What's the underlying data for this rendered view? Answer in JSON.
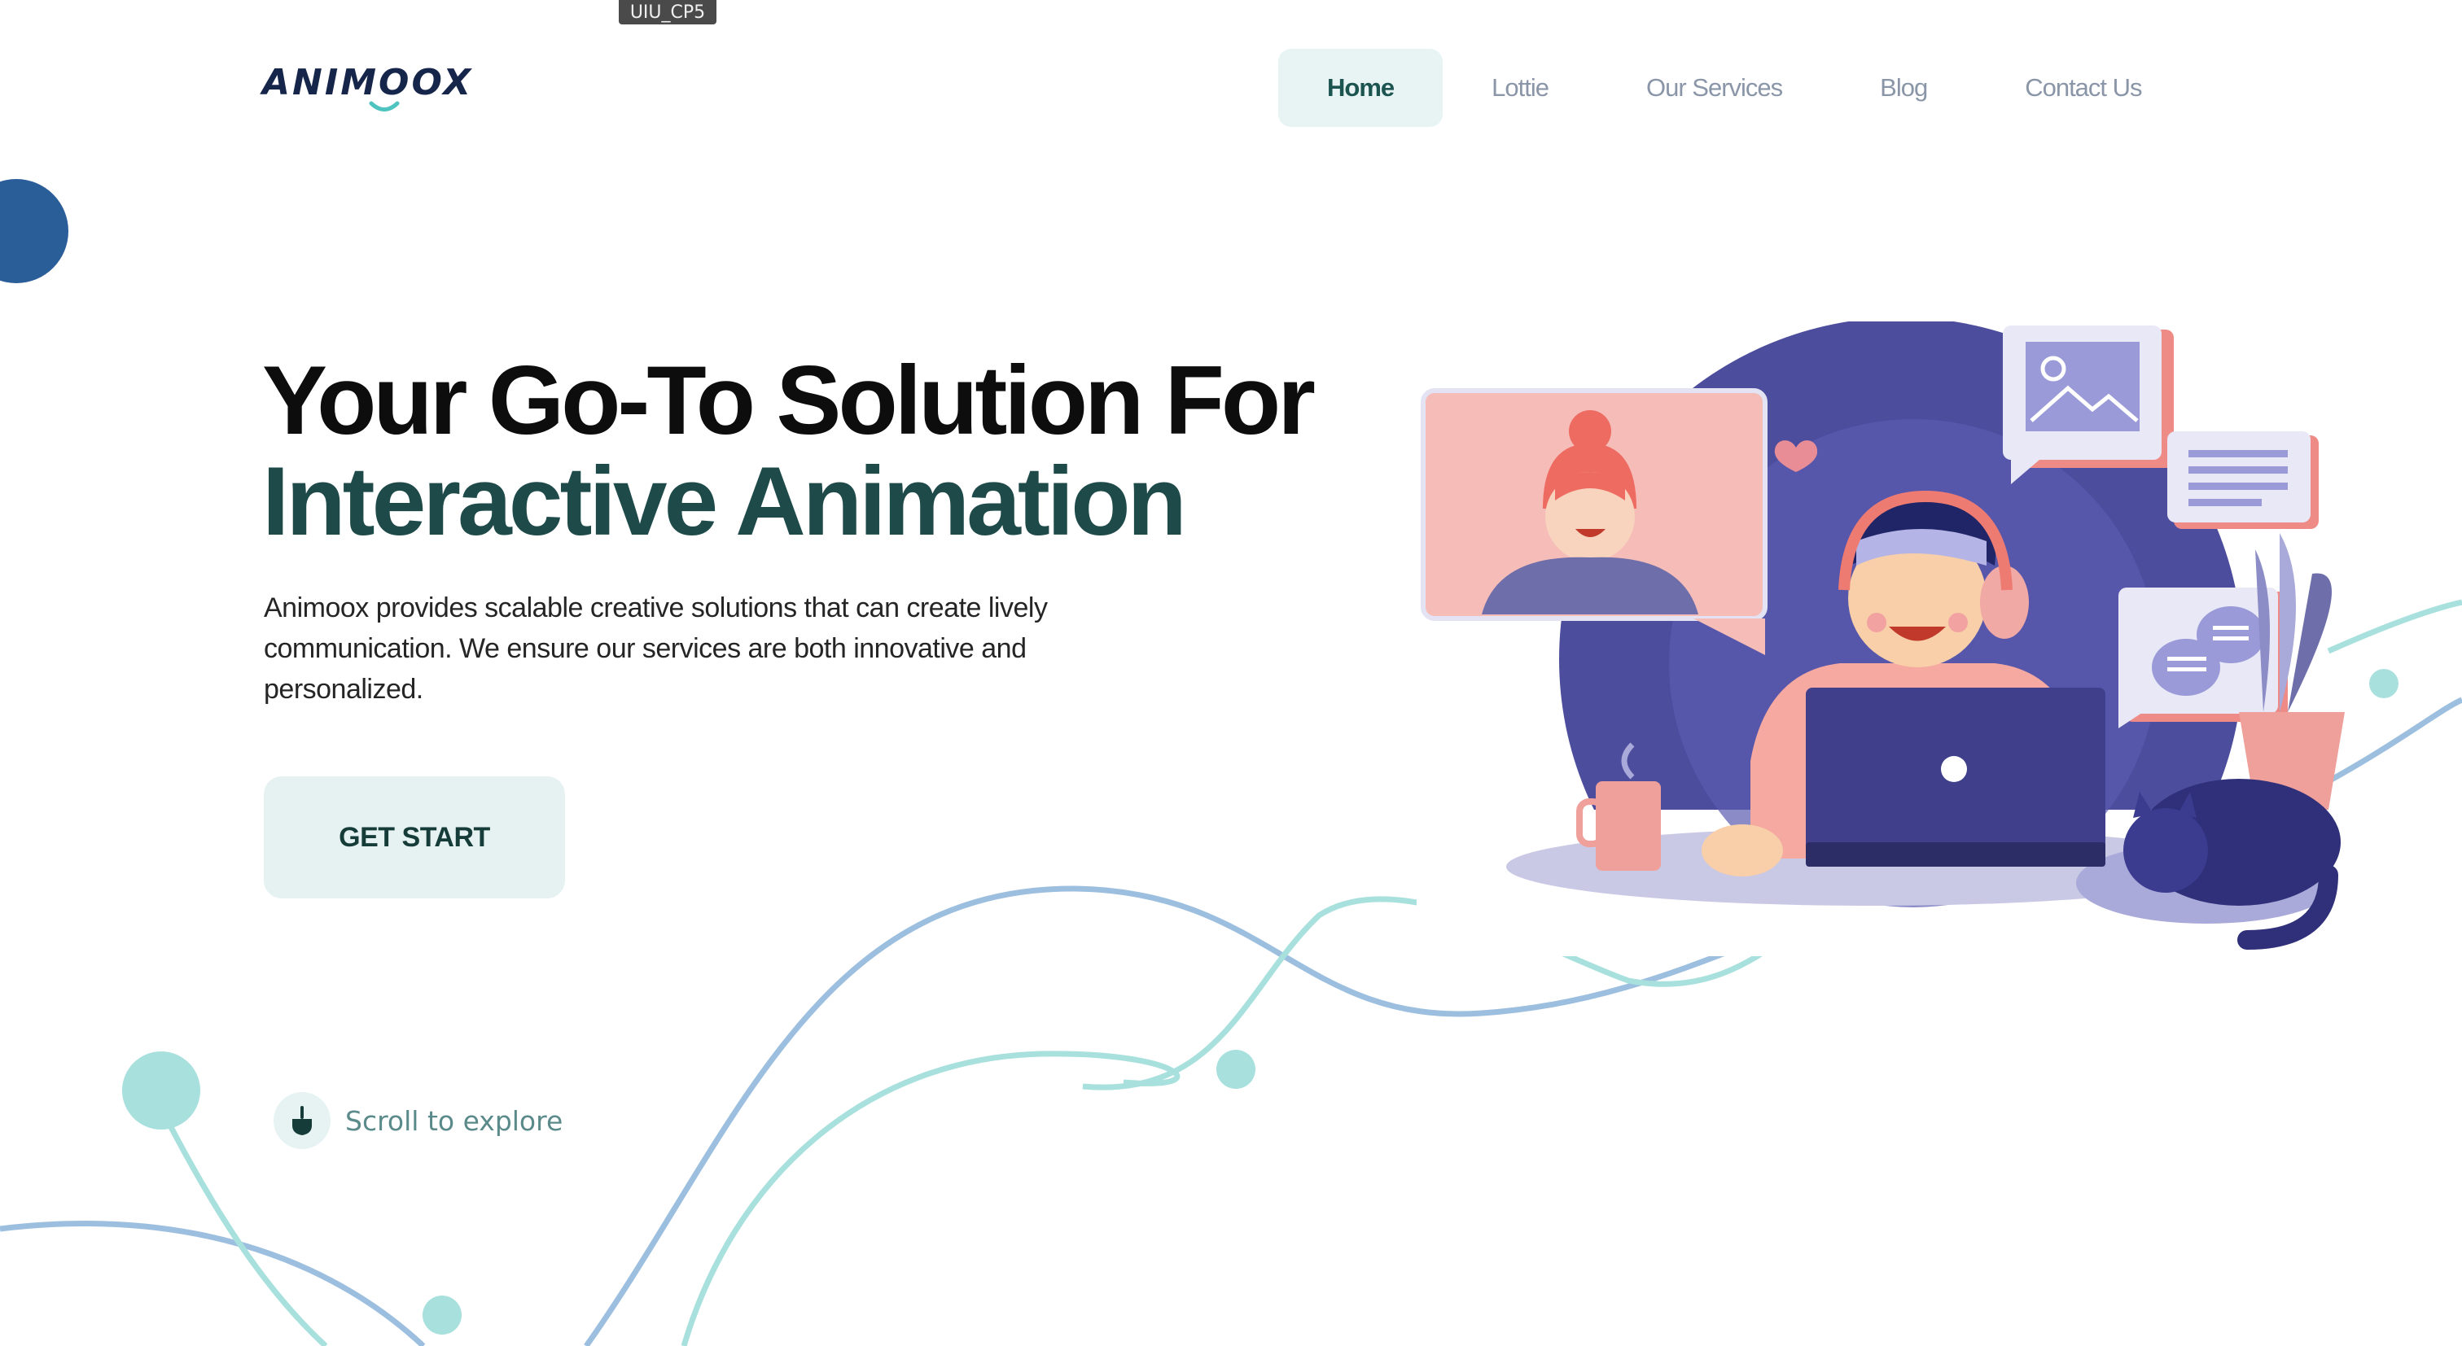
{
  "tooltip": "UIU_CP5",
  "logo": {
    "text": "ANIMOOX"
  },
  "nav": {
    "items": [
      {
        "label": "Home",
        "active": true
      },
      {
        "label": "Lottie",
        "active": false
      },
      {
        "label": "Our Services",
        "active": false
      },
      {
        "label": "Blog",
        "active": false
      },
      {
        "label": "Contact Us",
        "active": false
      }
    ]
  },
  "hero": {
    "title_line1": "Your Go-To Solution For",
    "title_line2": "Interactive Animation",
    "description": "Animoox provides scalable creative solutions that can create lively communication. We ensure our services are both innovative and personalized.",
    "cta_label": "GET START",
    "scroll_label": "Scroll to explore"
  },
  "colors": {
    "brand_dark": "#16254a",
    "accent_teal": "#1f4a4a",
    "nav_active_bg": "#e8f3f3",
    "wave_blue": "#9dbfdf",
    "wave_teal": "#a7e0dc",
    "illustration_purple": "#4d4d9e",
    "illustration_pink": "#f0a9a4"
  },
  "icons": {
    "scroll": "hand-pointer-down-icon",
    "logo_mark": "smile-arc-icon"
  }
}
